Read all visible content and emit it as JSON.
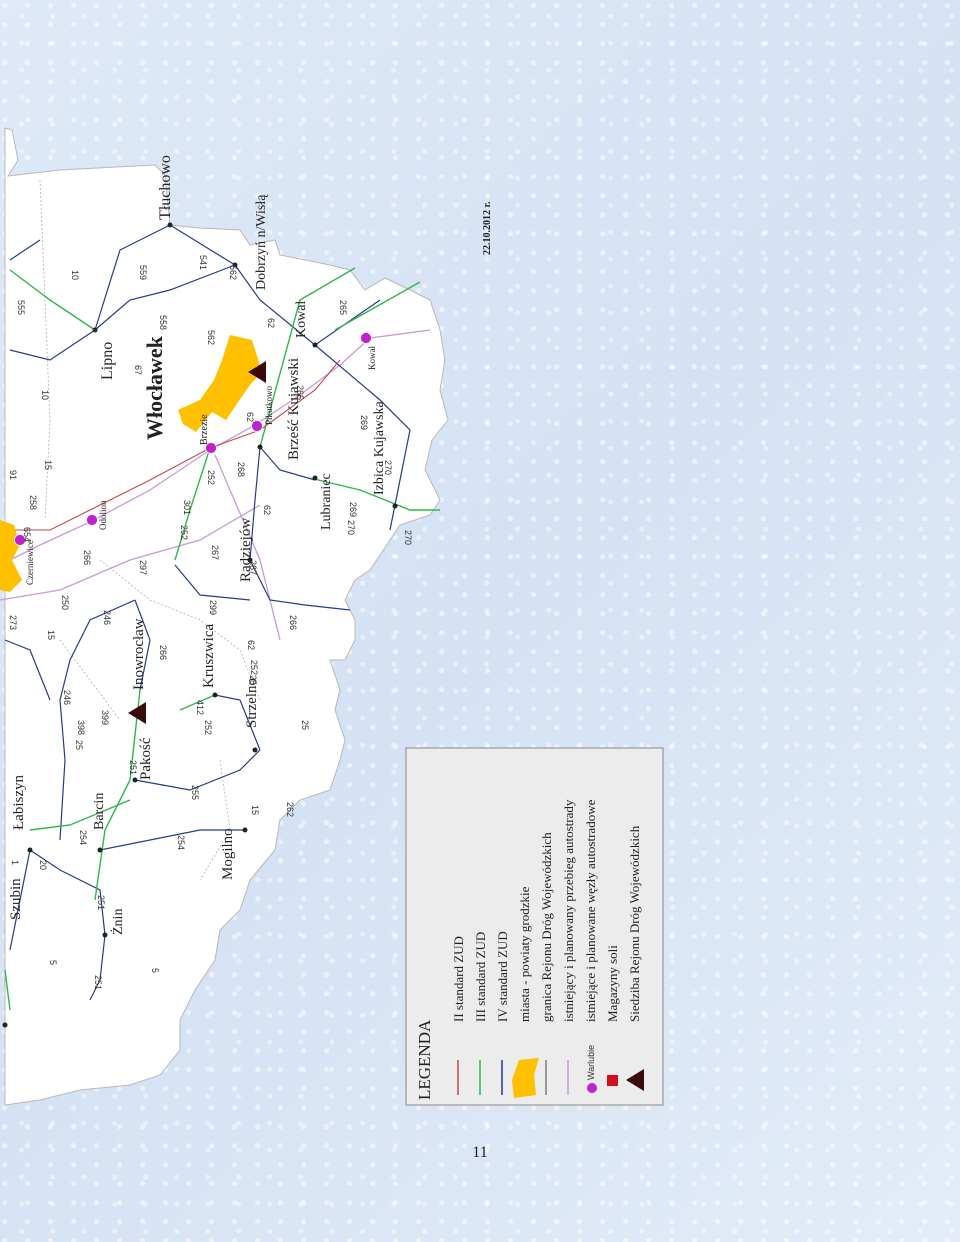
{
  "date_note": "22.10.2012 r.",
  "page_number": "11",
  "region_title": "Włocławek",
  "towns": [
    "Tłuchowo",
    "Dobrzyń n/Wisłą",
    "Lipno",
    "Kowal",
    "Brześć Kujawski",
    "Lubraniec",
    "Izbica Kujawska",
    "Radziejów",
    "Kruszwica",
    "Inowrocław",
    "Strzelno",
    "Pakość",
    "Mogilno",
    "Barcin",
    "Łabiszyn",
    "Szubin",
    "Żnin",
    "Brzezie",
    "Pikutkowo",
    "Odolion",
    "Czerniewice",
    "Kowal"
  ],
  "road_numbers": [
    "10",
    "559",
    "541",
    "562",
    "265",
    "555",
    "558",
    "562",
    "62",
    "10",
    "67",
    "265",
    "269",
    "62",
    "252",
    "268",
    "91",
    "15",
    "258",
    "269",
    "270",
    "62",
    "270",
    "270",
    "654",
    "266",
    "301",
    "252",
    "267",
    "267",
    "297",
    "250",
    "273",
    "15",
    "246",
    "266",
    "252",
    "62",
    "266",
    "299",
    "25",
    "412",
    "246",
    "399",
    "398",
    "25",
    "255",
    "251",
    "25",
    "254",
    "254",
    "15",
    "262",
    "251",
    "5",
    "251",
    "5",
    "252",
    "20",
    "1"
  ],
  "legend": {
    "title": "LEGENDA",
    "items": [
      {
        "symbol": "line-red",
        "label": "II standard ZUD",
        "color": "#c8474a"
      },
      {
        "symbol": "line-green",
        "label": "III standard ZUD",
        "color": "#2fb84a"
      },
      {
        "symbol": "line-blue",
        "label": "IV standard ZUD",
        "color": "#243c8c"
      },
      {
        "symbol": "town-area",
        "label": "miasta - powiaty grodzkie",
        "color": "#ffc000"
      },
      {
        "symbol": "line-gray",
        "label": "granica Rejonu Dróg Wojewódzkich",
        "color": "#9a9a9a"
      },
      {
        "symbol": "line-pink",
        "label": "istniejący i planowany przebieg autostrady",
        "color": "#c89ad8"
      },
      {
        "symbol": "dot-magenta",
        "label": "istniejące i planowane węzły autostradowe",
        "sublabel": "Warlubie",
        "color": "#c020d0"
      },
      {
        "symbol": "square-red",
        "label": "Magazyny soli",
        "color": "#d01020"
      },
      {
        "symbol": "triangle-dark",
        "label": "Siedziba Rejonu Dróg Wojewódzkich",
        "color": "#3a0a0a"
      }
    ]
  },
  "colors": {
    "land": "#ffffff",
    "sea": "#dde8f6",
    "town_fill": "#ffc000",
    "road_red": "#c8474a",
    "road_green": "#2fb84a",
    "road_blue": "#243c8c",
    "boundary": "#9a9a9a",
    "motorway": "#c89ad8",
    "node": "#c020d0",
    "hq": "#3a0a0a"
  }
}
